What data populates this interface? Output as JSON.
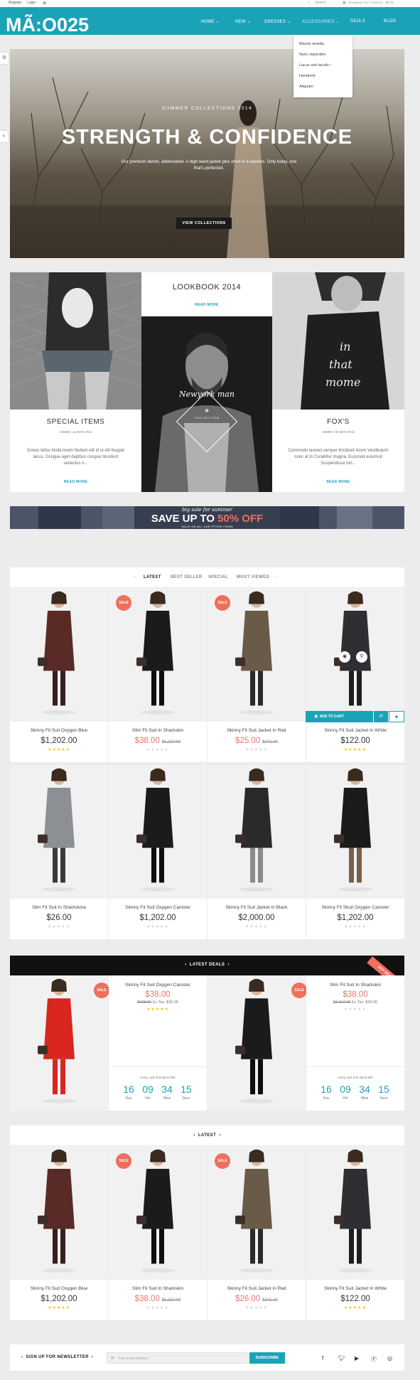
{
  "header": {
    "brand": "MÃ:O025",
    "top_links": [
      "Register",
      "Login"
    ],
    "search_label": "Search",
    "cart_text": "Shopping Cart: 0 item(s) - $0.00",
    "nav": [
      "HOME",
      "NEW",
      "DRESSES",
      "ACCESSORIES",
      "DEALS",
      "BLOG"
    ],
    "dropdown": [
      "Mauris ametta",
      "Nunc imperdiet",
      "Lacus sed iaculis",
      "Hendrerit",
      "Aliquam"
    ]
  },
  "hero": {
    "kicker": "SUMMER COLLECTIONS 2014",
    "title": "STRENGTH & CONFIDENCE",
    "text": "Our premium denim, abbreviated. A high waist jacket plus short in & washes. Only today, one that's perfected.",
    "button": "VIEW COLLECTIONS"
  },
  "lookbook": {
    "title": "LOOKBOOK 2014",
    "read_more": "READ MORE",
    "badge_title": "Newyork man",
    "badge_sub": "COLLECTION",
    "left": {
      "title": "SPECIAL ITEMS",
      "meta": "ADMIN / 11 MAR 2013",
      "text": "Donec tellus Nulla lorem Nullam elit id ut elit feugiat lacus. Congue eget dapibus congue tincidunt senectus n...",
      "read_more": "READ MORE"
    },
    "right": {
      "title": "FOX'S",
      "meta": "ADMIN / 05 MAR 2013",
      "text": "Commodo laoreet semper tincidunt lorem Vestibulum nunc at In Curabitur magna. Euismod euismod Suspendisse tort...",
      "read_more": "READ MORE"
    }
  },
  "banner": {
    "script": "big sale for summer",
    "title_prefix": "SAVE UP TO ",
    "title_highlight": "50% OFF",
    "sub": "VALID ON ALL OUR STORE ITEMS"
  },
  "tabs": [
    "LATEST",
    "BEST SELLER",
    "SPECIAL",
    "MOST VIEWED"
  ],
  "sale_label": "SALE",
  "add_to_cart": "ADD TO CART",
  "products_row1": [
    {
      "name": "Skinny Fit Suit Oxygen Blue",
      "price": "$1,202.00",
      "old": "",
      "sale": false,
      "rated": true
    },
    {
      "name": "Slim Fit Suit In Sharkskin",
      "price": "$38.00",
      "old": "$1,214.00",
      "sale": true,
      "rated": false
    },
    {
      "name": "Skinny Fit Suit Jacket In Red",
      "price": "$25.00",
      "old": "$241.00",
      "sale": true,
      "rated": false
    },
    {
      "name": "Skinny Fit Suit Jacket In White",
      "price": "$122.00",
      "old": "",
      "sale": false,
      "rated": true
    }
  ],
  "products_row2": [
    {
      "name": "Slim Fit Suit In Sharkskina",
      "price": "$26.00",
      "old": "",
      "sale": false,
      "rated": false
    },
    {
      "name": "Skinny Fit Suit Oxygen Canister",
      "price": "$1,202.00",
      "old": "",
      "sale": false,
      "rated": false
    },
    {
      "name": "Skinny Fit Suit Jacket In Black",
      "price": "$2,000.00",
      "old": "",
      "sale": false,
      "rated": false
    },
    {
      "name": "Skinny Fit Skuit Oxygen Canister",
      "price": "$1,202.00",
      "old": "",
      "sale": false,
      "rated": false
    }
  ],
  "deals": {
    "title": "LATEST DEALS",
    "ribbon": "HOT DEALS",
    "items": [
      {
        "name": "Skinny Fit Suit Oxygen Canister",
        "price": "$38.00",
        "old": "$128.00",
        "tax": "Ex Tax: $30.00",
        "hurry": "Hurry, just 572 items left!",
        "rated": true
      },
      {
        "name": "Slim Fit Suit In Sharkskin",
        "price": "$38.00",
        "old": "$1,214.00",
        "tax": "Ex Tax: $30.00",
        "hurry": "Hurry, just 572 items left!",
        "rated": false
      }
    ],
    "countdown": [
      {
        "value": "16",
        "label": "Day"
      },
      {
        "value": "09",
        "label": "Hrs"
      },
      {
        "value": "34",
        "label": "Mins"
      },
      {
        "value": "15",
        "label": "Secs"
      }
    ]
  },
  "latest": {
    "title": "LATEST",
    "products": [
      {
        "name": "Skinny Fit Suit Oxygen Blue",
        "price": "$1,202.00",
        "old": "",
        "sale": false,
        "rated": true
      },
      {
        "name": "Slim Fit Suit In Sharkskin",
        "price": "$38.00",
        "old": "$1,214.00",
        "sale": true,
        "rated": false
      },
      {
        "name": "Skinny Fit Suit Jacket In Red",
        "price": "$26.00",
        "old": "$241.00",
        "sale": true,
        "rated": false
      },
      {
        "name": "Skinny Fit Suit Jacket In White",
        "price": "$122.00",
        "old": "",
        "sale": false,
        "rated": true
      }
    ]
  },
  "newsletter": {
    "title": "SIGN UP FOR NEWSLETTER",
    "placeholder": "Your email address",
    "button": "SUBSCRIBE"
  },
  "icons": [
    "settings-icon",
    "contrast-icon",
    "facebook-icon",
    "twitter-icon",
    "youtube-icon",
    "pinterest-icon",
    "dribbble-icon",
    "search-icon",
    "cart-icon",
    "quick-view-icon",
    "zoom-icon",
    "compare-icon",
    "wishlist-icon"
  ],
  "colors": {
    "accent": "#1aa3b6",
    "sale": "#ef6e5c",
    "stars": "#f4c21a"
  }
}
